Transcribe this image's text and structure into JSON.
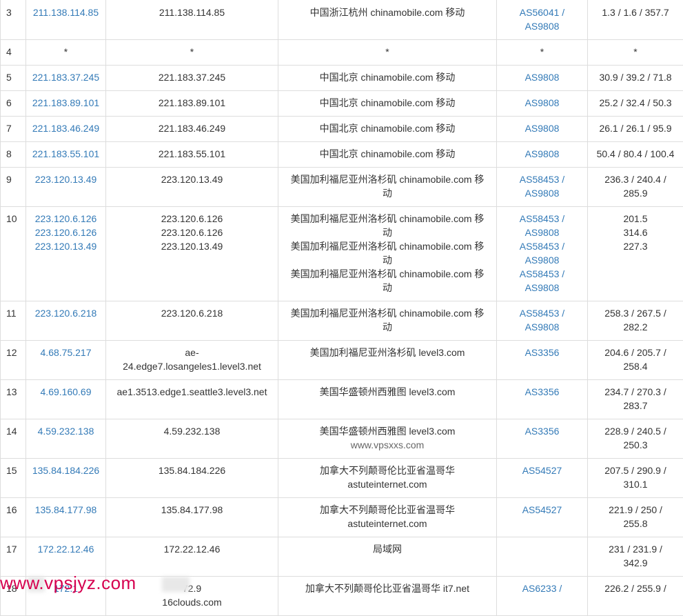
{
  "rows": [
    {
      "hop": "3",
      "ip": [
        "211.138.114.85"
      ],
      "host": [
        "211.138.114.85"
      ],
      "loc": [
        "中国浙江杭州 chinamobile.com 移动"
      ],
      "as": [
        "AS56041 /",
        "AS9808"
      ],
      "lat": [
        "1.3 / 1.6 / 357.7"
      ],
      "h": 57
    },
    {
      "hop": "4",
      "ip": [
        "*"
      ],
      "host": [
        "*"
      ],
      "loc": [
        "*"
      ],
      "as": [
        "*"
      ],
      "lat": [
        "*"
      ],
      "h": 37,
      "star": true
    },
    {
      "hop": "5",
      "ip": [
        "221.183.37.245"
      ],
      "host": [
        "221.183.37.245"
      ],
      "loc": [
        "中国北京 chinamobile.com 移动"
      ],
      "as": [
        "AS9808"
      ],
      "lat": [
        "30.9 / 39.2 / 71.8"
      ],
      "h": 37
    },
    {
      "hop": "6",
      "ip": [
        "221.183.89.101"
      ],
      "host": [
        "221.183.89.101"
      ],
      "loc": [
        "中国北京 chinamobile.com 移动"
      ],
      "as": [
        "AS9808"
      ],
      "lat": [
        "25.2 / 32.4 / 50.3"
      ],
      "h": 37
    },
    {
      "hop": "7",
      "ip": [
        "221.183.46.249"
      ],
      "host": [
        "221.183.46.249"
      ],
      "loc": [
        "中国北京 chinamobile.com 移动"
      ],
      "as": [
        "AS9808"
      ],
      "lat": [
        "26.1 / 26.1 / 95.9"
      ],
      "h": 37
    },
    {
      "hop": "8",
      "ip": [
        "221.183.55.101"
      ],
      "host": [
        "221.183.55.101"
      ],
      "loc": [
        "中国北京 chinamobile.com 移动"
      ],
      "as": [
        "AS9808"
      ],
      "lat": [
        "50.4 / 80.4 / 100.4"
      ],
      "h": 37
    },
    {
      "hop": "9",
      "ip": [
        "223.120.13.49"
      ],
      "host": [
        "223.120.13.49"
      ],
      "loc": [
        "美国加利福尼亚州洛杉矶 chinamobile.com 移",
        "动"
      ],
      "as": [
        "AS58453 /",
        "AS9808"
      ],
      "lat": [
        "236.3 / 240.4 /",
        "285.9"
      ],
      "h": 57
    },
    {
      "hop": "10",
      "ip": [
        "223.120.6.126",
        "223.120.6.126",
        "223.120.13.49"
      ],
      "host": [
        "223.120.6.126",
        "223.120.6.126",
        "223.120.13.49"
      ],
      "loc": [
        "美国加利福尼亚州洛杉矶 chinamobile.com 移",
        "动",
        "美国加利福尼亚州洛杉矶 chinamobile.com 移",
        "动",
        "美国加利福尼亚州洛杉矶 chinamobile.com 移",
        "动"
      ],
      "as": [
        "AS58453 /",
        "AS9808",
        "AS58453 /",
        "AS9808",
        "AS58453 /",
        "AS9808"
      ],
      "lat": [
        "201.5",
        "314.6",
        "227.3"
      ],
      "h": 137
    },
    {
      "hop": "11",
      "ip": [
        "223.120.6.218"
      ],
      "host": [
        "223.120.6.218"
      ],
      "loc": [
        "美国加利福尼亚州洛杉矶 chinamobile.com 移",
        "动"
      ],
      "as": [
        "AS58453 /",
        "AS9808"
      ],
      "lat": [
        "258.3 / 267.5 /",
        "282.2"
      ],
      "h": 57
    },
    {
      "hop": "12",
      "ip": [
        "4.68.75.217"
      ],
      "host": [
        "ae-",
        "24.edge7.losangeles1.level3.net"
      ],
      "loc": [
        "美国加利福尼亚州洛杉矶 level3.com"
      ],
      "as": [
        "AS3356"
      ],
      "lat": [
        "204.6 / 205.7 /",
        "258.4"
      ],
      "h": 57
    },
    {
      "hop": "13",
      "ip": [
        "4.69.160.69"
      ],
      "host": [
        "ae1.3513.edge1.seattle3.level3.net"
      ],
      "loc": [
        "美国华盛顿州西雅图 level3.com"
      ],
      "as": [
        "AS3356"
      ],
      "lat": [
        "234.7 / 270.3 /",
        "283.7"
      ],
      "h": 57
    },
    {
      "hop": "14",
      "ip": [
        "4.59.232.138"
      ],
      "host": [
        "4.59.232.138"
      ],
      "loc": [
        "美国华盛顿州西雅图 level3.com",
        "www.vpsxxs.com"
      ],
      "as": [
        "AS3356"
      ],
      "lat": [
        "228.9 / 240.5 /",
        "250.3"
      ],
      "h": 57
    },
    {
      "hop": "15",
      "ip": [
        "135.84.184.226"
      ],
      "host": [
        "135.84.184.226"
      ],
      "loc": [
        "加拿大不列颠哥伦比亚省温哥华",
        "astuteinternet.com"
      ],
      "as": [
        "AS54527"
      ],
      "lat": [
        "207.5 / 290.9 /",
        "310.1"
      ],
      "h": 57
    },
    {
      "hop": "16",
      "ip": [
        "135.84.177.98"
      ],
      "host": [
        "135.84.177.98"
      ],
      "loc": [
        "加拿大不列颠哥伦比亚省温哥华",
        "astuteinternet.com"
      ],
      "as": [
        "AS54527"
      ],
      "lat": [
        "221.9 / 250 /",
        "255.8"
      ],
      "h": 57
    },
    {
      "hop": "17",
      "ip": [
        "172.22.12.46"
      ],
      "host": [
        "172.22.12.46"
      ],
      "loc": [
        "局域网"
      ],
      "as": [],
      "lat": [
        "231 / 231.9 /",
        "342.9"
      ],
      "h": 57
    },
    {
      "hop": "18",
      "ip": [
        "172.1"
      ],
      "host": [
        "72.9",
        "16clouds.com"
      ],
      "loc": [
        "加拿大不列颠哥伦比亚省温哥华 it7.net"
      ],
      "as": [
        "AS6233 /"
      ],
      "lat": [
        "226.2 / 255.9 /"
      ],
      "h": 57
    }
  ],
  "watermark_site": "www.vpsjyz.com",
  "inline_watermark": "www.vpsxxs.com"
}
